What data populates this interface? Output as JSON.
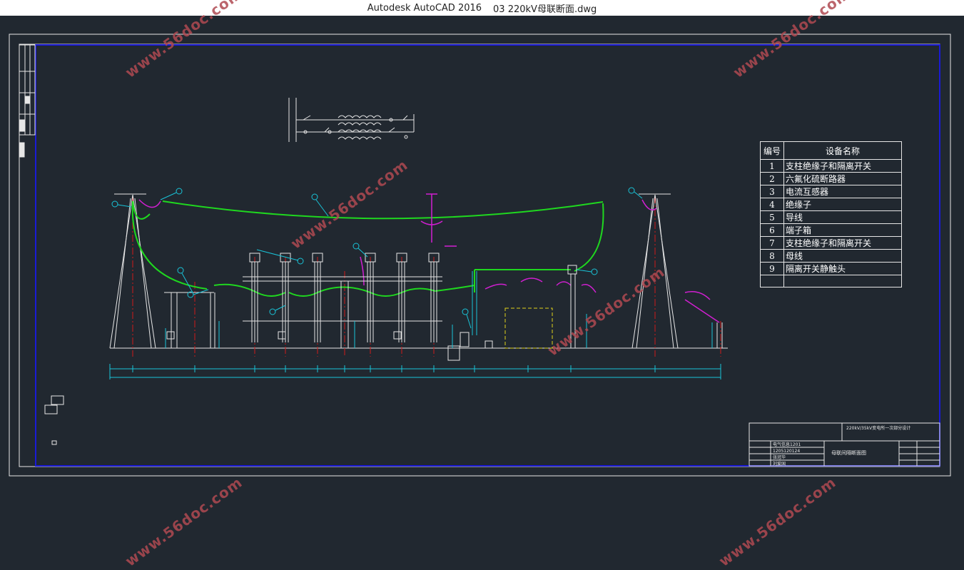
{
  "window": {
    "app_name": "Autodesk AutoCAD 2016",
    "file_name": "03 220kV母联断面.dwg"
  },
  "legend": {
    "header_num": "编号",
    "header_name": "设备名称",
    "rows": [
      {
        "num": "1",
        "name": "支柱绝缘子和隔离开关"
      },
      {
        "num": "2",
        "name": "六氟化硫断路器"
      },
      {
        "num": "3",
        "name": "电流互感器"
      },
      {
        "num": "4",
        "name": "绝缘子"
      },
      {
        "num": "5",
        "name": "导线"
      },
      {
        "num": "6",
        "name": "端子箱"
      },
      {
        "num": "7",
        "name": "支柱绝缘子和隔离开关"
      },
      {
        "num": "8",
        "name": "母线"
      },
      {
        "num": "9",
        "name": "隔离开关静触头"
      },
      {
        "num": "",
        "name": ""
      }
    ]
  },
  "title_block": {
    "project": "220kV/35kV变电所一次部分设计",
    "drawing_name": "母联间隔断面图",
    "class_text": "电气信息1201",
    "id_text": "1205120124",
    "name_text": "张冠华",
    "advisor_text": "刘爱国"
  },
  "watermarks": [
    "www.56doc.com",
    "www.56doc.com",
    "www.56doc.com",
    "www.56doc.com",
    "www.56doc.com",
    "www.56doc.com"
  ],
  "colors": {
    "background": "#212830",
    "frame_white": "#e6e6e6",
    "frame_blue": "#1a1ad6",
    "conductor_green": "#1fd81f",
    "annotation_cyan": "#19c4d8",
    "equipment_magenta": "#d21fd2",
    "centerline_red": "#d01a1a",
    "box_yellow": "#e0d21a",
    "watermark": "#b04a52"
  }
}
